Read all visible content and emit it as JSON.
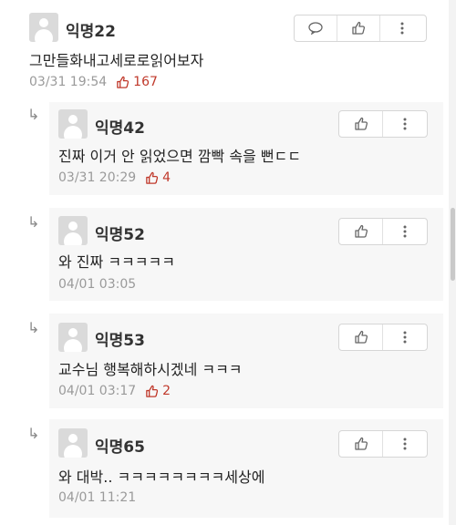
{
  "top_comment": {
    "author": "익명22",
    "text": "그만들화내고세로로읽어보자",
    "time": "03/31 19:54",
    "likes": "167"
  },
  "replies": [
    {
      "author": "익명42",
      "text": "진짜 이거 안 읽었으면 깜빡 속을 뻔ㄷㄷ",
      "time": "03/31 20:29",
      "likes": "4"
    },
    {
      "author": "익명52",
      "text": "와 진짜 ㅋㅋㅋㅋㅋ",
      "time": "04/01 03:05",
      "likes": ""
    },
    {
      "author": "익명53",
      "text": "교수님 행복해하시겠네 ㅋㅋㅋ",
      "time": "04/01 03:17",
      "likes": "2"
    },
    {
      "author": "익명65",
      "text": "와 대박.. ㅋㅋㅋㅋㅋㅋㅋㅋ세상에",
      "time": "04/01 11:21",
      "likes": ""
    }
  ],
  "icons": {
    "reply": "speech-bubble-icon",
    "like": "thumbs-up-icon",
    "more": "vertical-dots-icon",
    "reply_arrow": "reply-arrow-icon"
  },
  "colors": {
    "like_accent": "#c0392b",
    "meta_gray": "#9a9a9a"
  }
}
